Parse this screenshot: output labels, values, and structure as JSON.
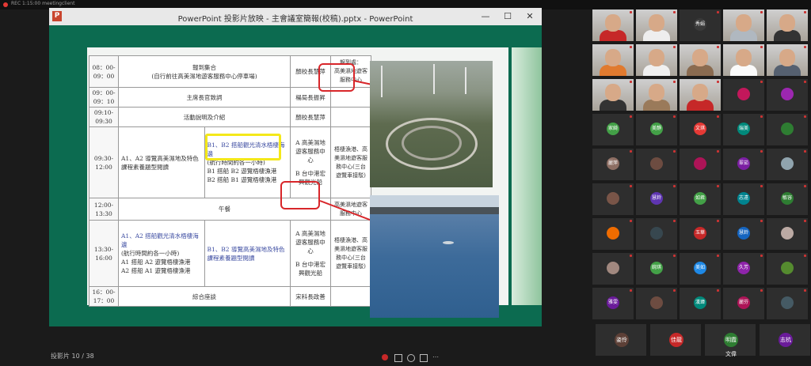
{
  "meeting": {
    "recording_text": "REC 1:15:00  meetingclient"
  },
  "window": {
    "title": "PowerPoint 投影片放映 - 主會議室簡報(校稿).pptx - PowerPoint",
    "app_icon_letter": "P",
    "minimize": "—",
    "maximize": "☐",
    "close": "✕"
  },
  "slide": {
    "rows": [
      {
        "time": "08：00-\n09：00",
        "activity": "報到集合\n(自行前往高美濕地遊客服務中心停車場)",
        "lead": "顏校長慧萍",
        "note": "報到處：\n高美濕地遊客服務中心"
      },
      {
        "time": "09：00-\n09：10",
        "activity": "主席長官致詞",
        "lead": "楊局長振昇",
        "note": ""
      },
      {
        "time": "09:10-\n09:30",
        "activity": "活動說明及介紹",
        "lead": "顏校長慧萍",
        "note": ""
      },
      {
        "time": "09:30-\n12:00",
        "act_a": "A1、A2 導覽高美濕地及特色課程素養題型閱讀",
        "act_b_top": "B1、B2 搭船觀光清水梧棲海邊",
        "act_b_sub": "(航行時間約各一小時)",
        "act_b_l1": "B1 搭船  B2 遊覽梧棲漁港",
        "act_b_l2": "B2 搭船  B1 遊覽梧棲漁港",
        "lead": "A 高美濕地遊客服務中心",
        "lead2": "B 台中港宏興觀光船",
        "note": "梧棲漁港、高美濕地遊客服務中心(三台遊覽車接駁)"
      },
      {
        "time": "12:00-\n13:30",
        "activity": "午餐",
        "lead": "",
        "note": "高美濕地遊客服務中心"
      },
      {
        "time": "13:30-\n16:00",
        "act_a_top": "A1、A2 搭船觀光清水梧棲海邊",
        "act_a_sub": "(航行時間約各一小時)",
        "act_a_l1": "A1 搭船  A2 遊覽梧棲漁港",
        "act_a_l2": "A2 搭船  A1 遊覽梧棲漁港",
        "act_b": "B1、B2 導覽高美濕地及特色課程素養題型閱讀",
        "lead": "A 高美濕地遊客服務中心",
        "lead2": "B 台中港宏興觀光船",
        "note": "梧棲漁港、高美濕地遊客服務中心(三台遊覽車接駁)"
      },
      {
        "time": "16：00-\n17：00",
        "activity": "綜合座談",
        "lead": "宋科長政善",
        "note": ""
      }
    ]
  },
  "controls": {
    "slide_counter": "投影片 10 / 38"
  },
  "participants": [
    {
      "name": "",
      "type": "video",
      "color": "#c62828"
    },
    {
      "name": "",
      "type": "video",
      "color": "#eeeeee"
    },
    {
      "name": "秀娟",
      "type": "avatar",
      "color": "#3a3a3a"
    },
    {
      "name": "",
      "type": "video",
      "color": "#b0b8c0"
    },
    {
      "name": "",
      "type": "video",
      "color": "#333333"
    },
    {
      "name": "",
      "type": "video",
      "color": "#e07a2f"
    },
    {
      "name": "",
      "type": "video",
      "color": "#f0f0f0"
    },
    {
      "name": "",
      "type": "video",
      "color": "#8a6b50"
    },
    {
      "name": "",
      "type": "video",
      "color": "#fafafa"
    },
    {
      "name": "",
      "type": "video",
      "color": "#556070"
    },
    {
      "name": "",
      "type": "video",
      "color": "#333333"
    },
    {
      "name": "",
      "type": "video",
      "color": "#9a7a5a"
    },
    {
      "name": "",
      "type": "video",
      "color": "#c62828"
    },
    {
      "name": "",
      "type": "avatar",
      "color": "#c2185b"
    },
    {
      "name": "",
      "type": "avatar",
      "color": "#9c27b0"
    },
    {
      "name": "家綺",
      "type": "avatar",
      "color": "#43a047"
    },
    {
      "name": "美靜",
      "type": "avatar",
      "color": "#43a047"
    },
    {
      "name": "文琪",
      "type": "avatar",
      "color": "#e53935"
    },
    {
      "name": "瑞美",
      "type": "avatar",
      "color": "#00897b"
    },
    {
      "name": "",
      "type": "avatar",
      "color": "#2e7d32"
    },
    {
      "name": "麗萍",
      "type": "avatar",
      "color": "#8d6e63"
    },
    {
      "name": "",
      "type": "avatar",
      "color": "#6d4c41"
    },
    {
      "name": "",
      "type": "avatar",
      "color": "#ad1457"
    },
    {
      "name": "翠茹",
      "type": "avatar",
      "color": "#7b1fa2"
    },
    {
      "name": "",
      "type": "avatar",
      "color": "#90a4ae"
    },
    {
      "name": "",
      "type": "avatar",
      "color": "#795548"
    },
    {
      "name": "慧鈴",
      "type": "avatar",
      "color": "#5e35b1"
    },
    {
      "name": "如君",
      "type": "avatar",
      "color": "#43a047"
    },
    {
      "name": "志遠",
      "type": "avatar",
      "color": "#00838f"
    },
    {
      "name": "敏容",
      "type": "avatar",
      "color": "#2e7d32"
    },
    {
      "name": "",
      "type": "avatar",
      "color": "#ef6c00"
    },
    {
      "name": "",
      "type": "avatar",
      "color": "#37474f"
    },
    {
      "name": "玉華",
      "type": "avatar",
      "color": "#c62828"
    },
    {
      "name": "慧鈴",
      "type": "avatar",
      "color": "#1565c0"
    },
    {
      "name": "",
      "type": "avatar",
      "color": "#bcaaa4"
    },
    {
      "name": "",
      "type": "avatar",
      "color": "#a1887f"
    },
    {
      "name": "婉琪",
      "type": "avatar",
      "color": "#43a047"
    },
    {
      "name": "美如",
      "type": "avatar",
      "color": "#1e88e5"
    },
    {
      "name": "久芳",
      "type": "avatar",
      "color": "#8e24aa"
    },
    {
      "name": "",
      "type": "avatar",
      "color": "#558b2f"
    },
    {
      "name": "雅雯",
      "type": "avatar",
      "color": "#6a1b9a"
    },
    {
      "name": "",
      "type": "avatar",
      "color": "#6d4c41"
    },
    {
      "name": "漢瑋",
      "type": "avatar",
      "color": "#00897b"
    },
    {
      "name": "麗芬",
      "type": "avatar",
      "color": "#ad1457"
    },
    {
      "name": "",
      "type": "avatar",
      "color": "#455a64"
    }
  ],
  "bottom_row": [
    {
      "name": "姿伶",
      "color": "#5d4037"
    },
    {
      "name": "佳龍",
      "color": "#c62828"
    },
    {
      "name": "明霞 文偉",
      "color": "#2e7d32"
    },
    {
      "name": "志杭",
      "color": "#6a1b9a"
    }
  ]
}
